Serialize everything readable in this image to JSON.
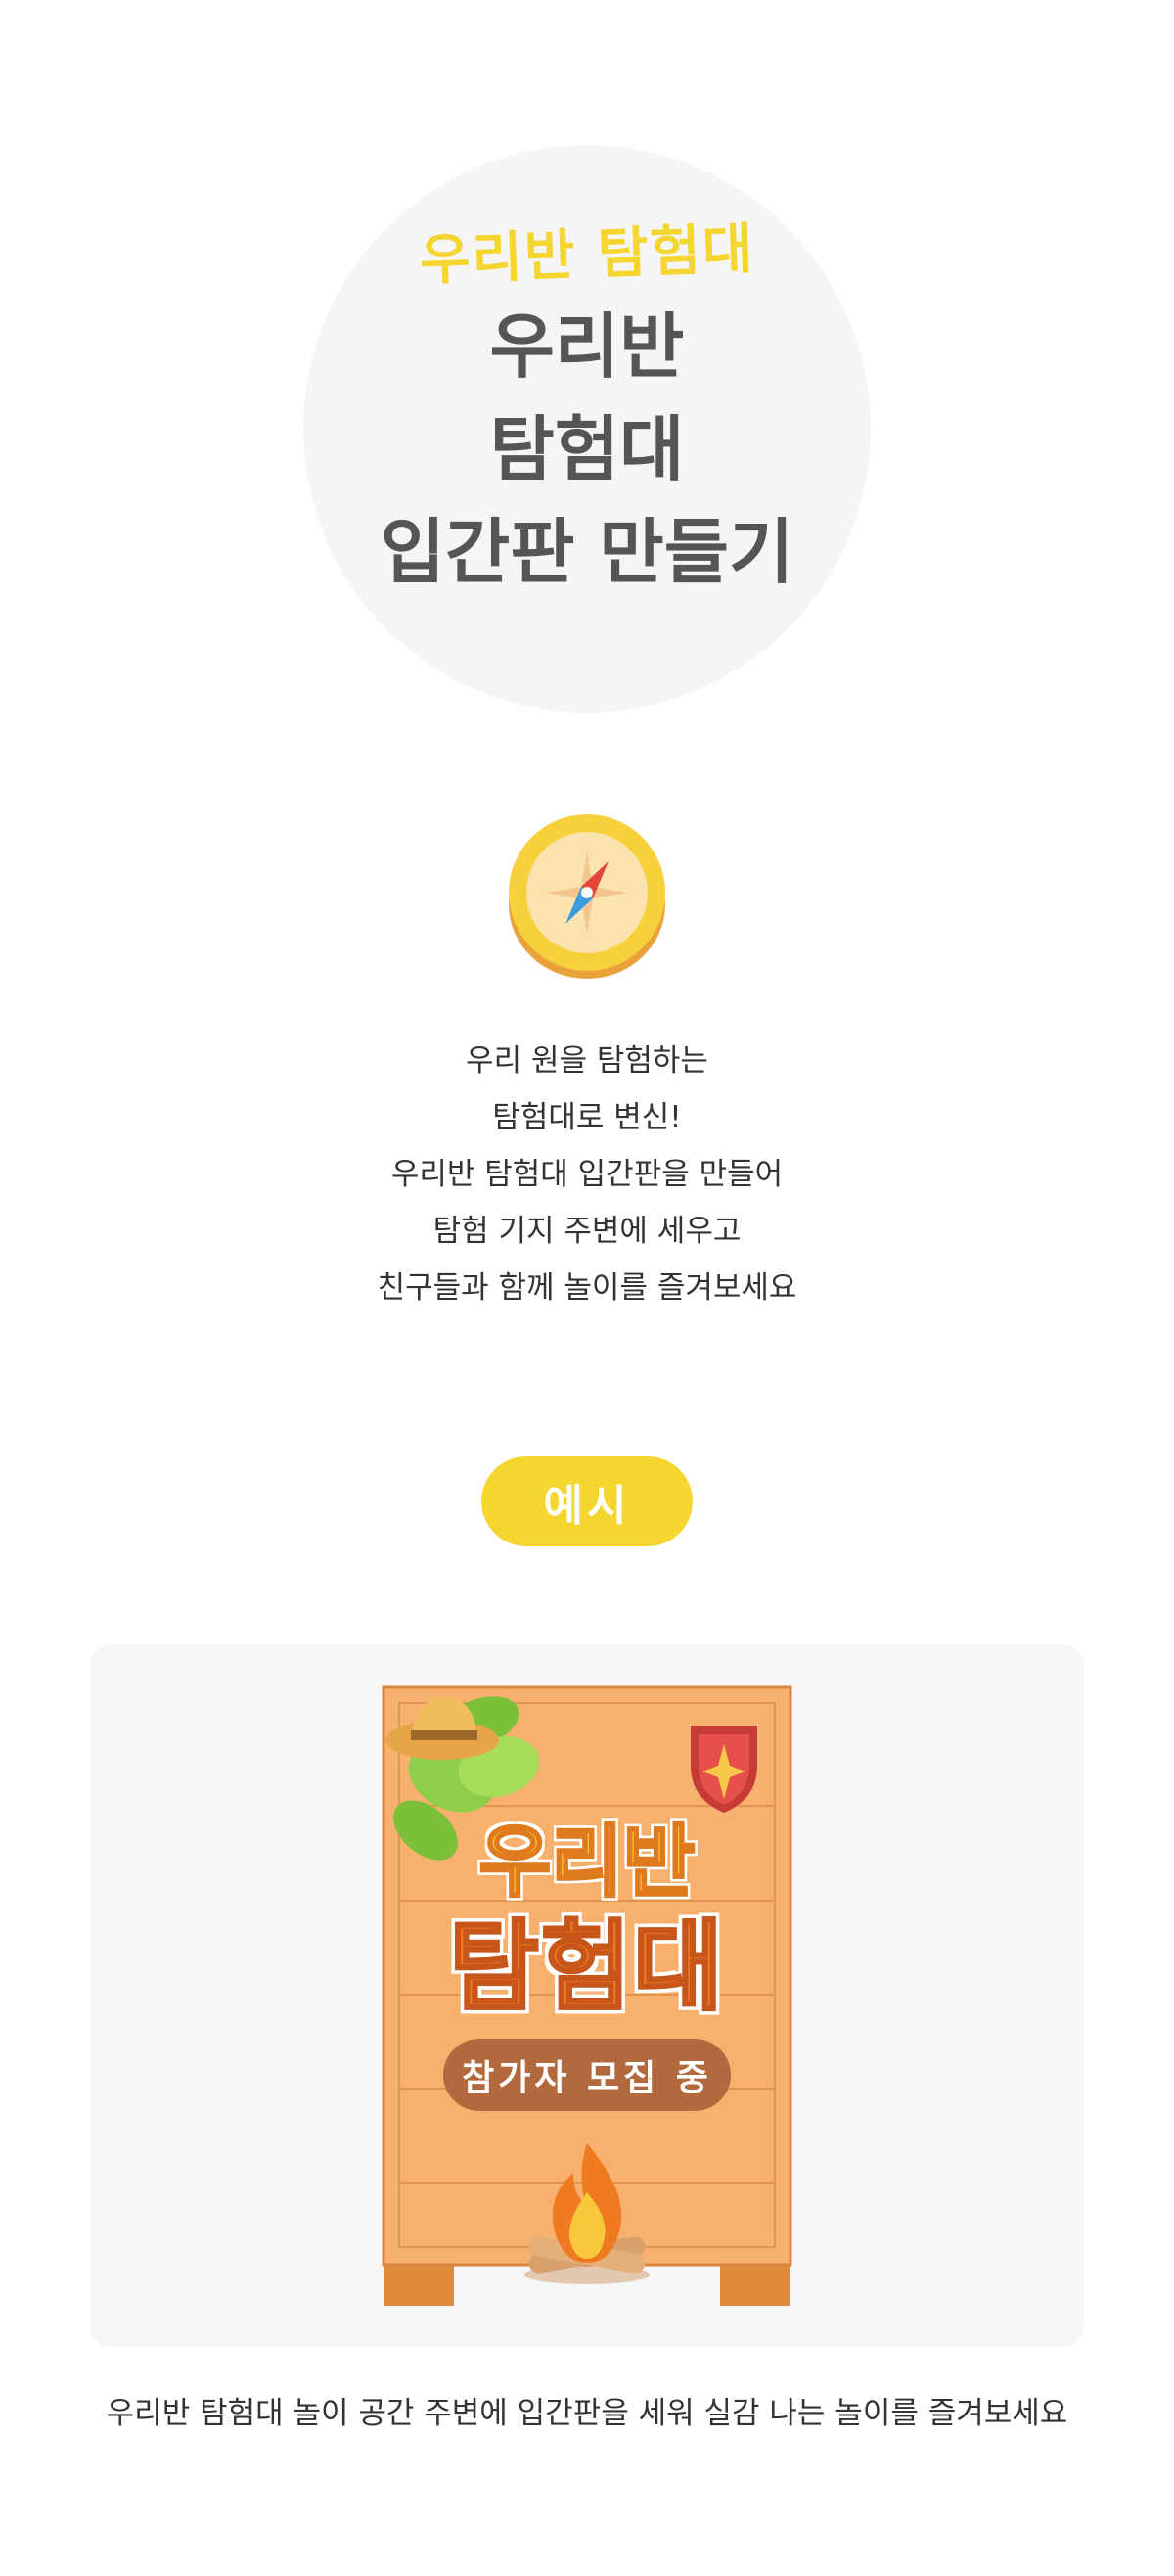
{
  "hero": {
    "subtitle": "우리반 탐험대",
    "title_lines": [
      "우리반",
      "탐험대",
      "입간판 만들기"
    ]
  },
  "description": {
    "lines": [
      "우리 원을 탐험하는",
      "탐험대로 변신!",
      "우리반 탐험대 입간판을 만들어",
      "탐험 기지 주변에 세우고",
      "친구들과 함께 놀이를 즐겨보세요"
    ]
  },
  "example": {
    "badge_label": "예시",
    "sign": {
      "title_top": "우리반",
      "title_main": "탐험대",
      "pill_text": "참가자 모집 중"
    },
    "caption": "우리반 탐험대 놀이 공간 주변에 입간판을 세워 실감 나는 놀이를 즐겨보세요"
  },
  "icons": {
    "compass": "compass-icon",
    "hat": "explorer-hat-icon",
    "leaves": "leaves-icon",
    "shield": "shield-icon",
    "campfire": "campfire-icon"
  },
  "colors": {
    "accent_yellow": "#f5d530",
    "hero_text": "#555555",
    "sign_wood": "#f7b06d",
    "sign_border": "#d9853e",
    "pill_brown": "#b2693d",
    "panel_bg": "#f6f6f6"
  }
}
